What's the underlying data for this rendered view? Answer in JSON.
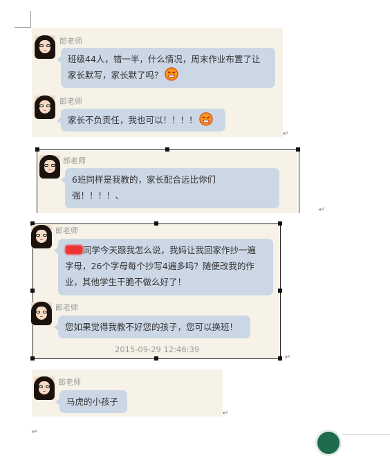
{
  "panels": [
    {
      "messages": [
        {
          "sender": "郎老师",
          "text": "班级44人，错一半，什么情况，周末作业布置了让家长默写，家长默了吗？",
          "emoji": "angry-face-icon"
        },
        {
          "sender": "郎老师",
          "text": "家长不负责任，我也可以！！！！",
          "emoji": "angry-face-icon"
        }
      ]
    },
    {
      "messages": [
        {
          "sender": "郎老师",
          "text_line1": "6班同样是我教的，家长配合远比你们",
          "text_line2": "强！！！！、"
        }
      ]
    },
    {
      "messages": [
        {
          "sender": "郎老师",
          "redacted": "redacted-name",
          "text_line1": "同学今天跟我怎么说，我妈让我回家作抄一遍",
          "text_line2": "字母，26个字母每个抄写4遍多吗？随便改我的作",
          "text_line3": "业，其他学生干脆不做么好了！"
        },
        {
          "sender": "郎老师",
          "text": "您如果觉得我教不好您的孩子，您可以换班！"
        }
      ],
      "timestamp": "2015-09-29 12:46:39"
    },
    {
      "messages": [
        {
          "sender": "郎老师",
          "text": "马虎的小孩子"
        }
      ]
    }
  ],
  "paragraph_mark": "↵",
  "colors": {
    "panel_bg": "#f6f2e7",
    "bubble_bg": "#ccd7e6",
    "sender_text": "#9a9a9a"
  }
}
